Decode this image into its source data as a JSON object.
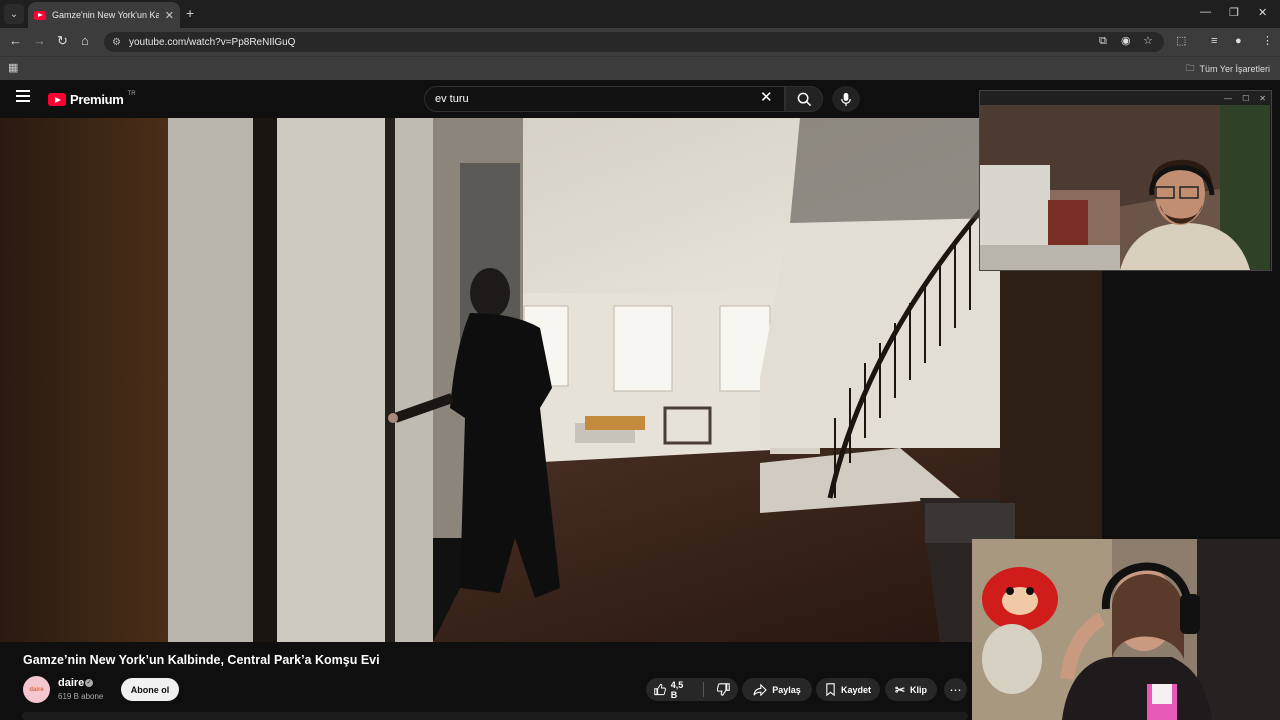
{
  "browser": {
    "tab_title": "Gamze'nin New York'un Kalbinde",
    "url": "youtube.com/watch?v=Pp8ReNIlGuQ",
    "bookmarks_label": "Tüm Yer İşaretleri",
    "window_controls": [
      "—",
      "❐",
      "✕"
    ],
    "nav_icons": [
      "back-icon",
      "forward-icon",
      "reload-icon",
      "home-icon"
    ]
  },
  "youtube": {
    "logo_text": "Premium",
    "region": "TR",
    "search_value": "ev turu",
    "video_title": "Gamze’nin New York’un Kalbinde, Central Park’a Komşu Evi",
    "channel": {
      "name": "daire",
      "subscribers": "619 B abone",
      "avatar_text": "daire"
    },
    "subscribe_label": "Abone ol",
    "actions": {
      "likes": "4,5 B",
      "share": "Paylaş",
      "save": "Kaydet",
      "clip": "Klip"
    }
  },
  "colors": {
    "youtube_red": "#ff0033",
    "background": "#0f0f0f",
    "pill": "#272727"
  }
}
